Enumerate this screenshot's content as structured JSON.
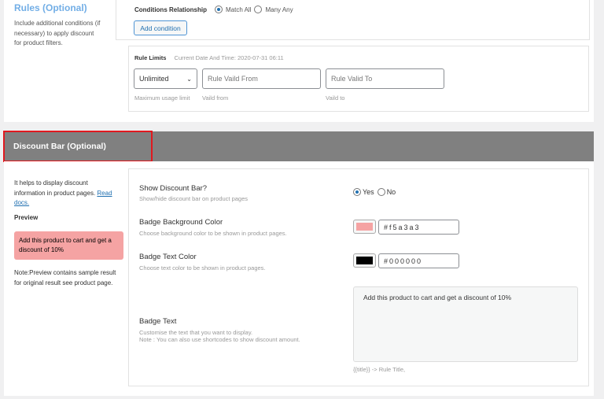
{
  "rules": {
    "title": "Rules (Optional)",
    "description": "Include additional conditions (if necessary) to apply discount for product filters.",
    "conditions_relationship_label": "Conditions Relationship",
    "options": [
      "Match All",
      "Many Any"
    ],
    "selected": "Match All",
    "add_condition_label": "Add condition",
    "rule_limits_label": "Rule Limits",
    "current_datetime": "Current Date And Time: 2020-07-31 06:11",
    "usage_select_value": "Unlimited",
    "valid_from_placeholder": "Rule Vaild From",
    "valid_to_placeholder": "Rule Valid To",
    "usage_hint": "Maximum usage limit",
    "valid_from_hint": "Vaild from",
    "valid_to_hint": "Vaild to"
  },
  "discount_bar": {
    "title": "Discount Bar (Optional)",
    "description": "It helps to display discount information in product pages.",
    "read_docs": "Read docs.",
    "preview_label": "Preview",
    "preview_text": "Add this product to cart and get a discount of 10%",
    "note": "Note:Preview contains sample result for original result see product page.",
    "show_label": "Show Discount Bar?",
    "show_hint": "Show/hide discount bar on product pages",
    "yes": "Yes",
    "no": "No",
    "bg_label": "Badge Background Color",
    "bg_hint": "Choose background color to be shown in product pages.",
    "bg_value": "#f5a3a3",
    "text_color_label": "Badge Text Color",
    "text_color_hint": "Choose text color to be shown in product pages.",
    "text_color_value": "#000000",
    "badge_text_label": "Badge Text",
    "badge_text_hint": "Customise the text that you want to display.",
    "badge_text_note": "Note : You can also use shortcodes to show discount amount.",
    "badge_text_value": "Add this product to cart and get a discount of 10%",
    "shortcode_hint": "{{title}} -> Rule Title,"
  },
  "colors": {
    "header_bg": "#808080",
    "highlight": "#e0191f",
    "preview_bg": "#f5a3a3"
  }
}
